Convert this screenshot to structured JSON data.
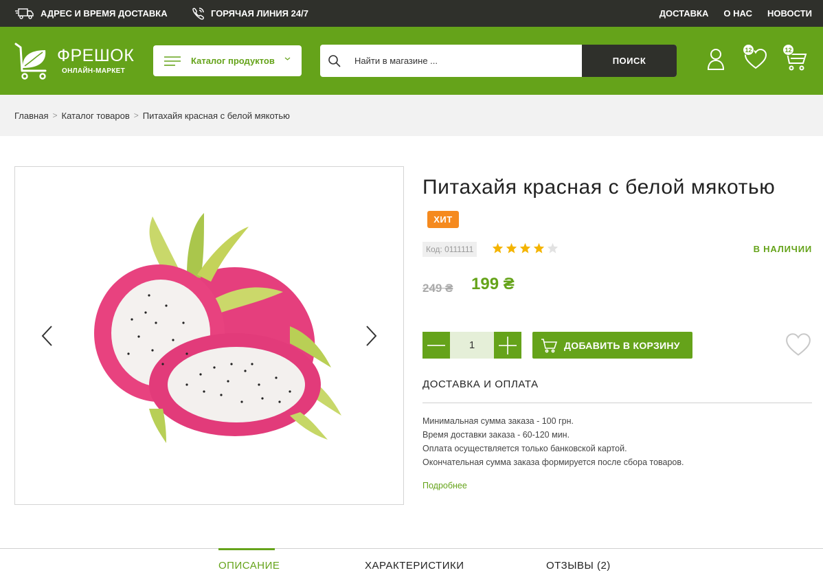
{
  "topbar": {
    "delivery": "АДРЕС И ВРЕМЯ ДОСТАВКА",
    "hotline": "ГОРЯЧАЯ ЛИНИЯ 24/7",
    "links": [
      "ДОСТАВКА",
      "О НАС",
      "НОВОСТИ"
    ]
  },
  "header": {
    "logo_title": "ФРЕШОК",
    "logo_sub": "ОНЛАЙН-МАРКЕТ",
    "catalog_label": "Каталог продуктов",
    "search_placeholder": "Найти в магазине ...",
    "search_button": "ПОИСК",
    "wishlist_count": "12",
    "cart_count": "12"
  },
  "breadcrumb": [
    "Главная",
    "Каталог товаров",
    "Питахайя красная с белой мякотью"
  ],
  "product": {
    "title": "Питахайя красная с белой мякотью",
    "badge": "ХИТ",
    "code": "Код: 0111111",
    "rating": 4,
    "rating_max": 5,
    "stock": "В НАЛИЧИИ",
    "old_price": "249 ₴",
    "price": "199 ₴",
    "quantity": "1",
    "add_to_cart": "ДОБАВИТЬ В КОРЗИНУ"
  },
  "delivery": {
    "heading": "ДОСТАВКА И ОПЛАТА",
    "lines": [
      "Минимальная сумма заказа - 100 грн.",
      "Время доставки заказа - 60-120 мин.",
      "Оплата осуществляется только банковской картой.",
      "Окончательная сумма заказа формируется после сбора товаров."
    ],
    "more": "Подробнее"
  },
  "tabs": [
    "ОПИСАНИЕ",
    "ХАРАКТЕРИСТИКИ",
    "ОТЗЫВЫ (2)"
  ],
  "colors": {
    "brand_green": "#65a31a",
    "topbar_dark": "#2f302b",
    "badge_orange": "#f58a1f",
    "star_gold": "#f4b400"
  }
}
